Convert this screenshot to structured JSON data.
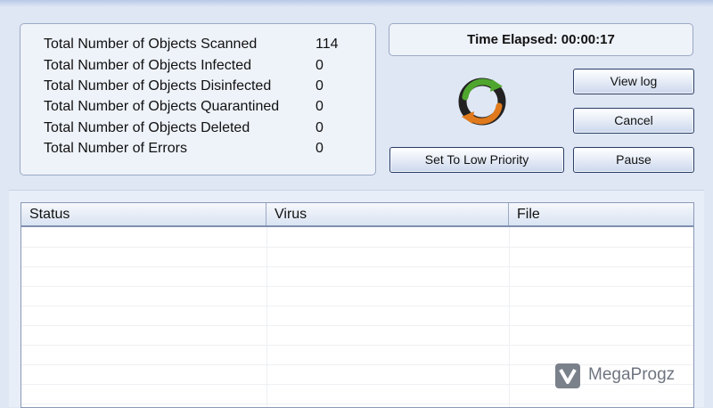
{
  "stats": [
    {
      "label": "Total Number of Objects Scanned",
      "value": "114"
    },
    {
      "label": "Total Number of Objects Infected",
      "value": "0"
    },
    {
      "label": "Total Number of Objects Disinfected",
      "value": "0"
    },
    {
      "label": "Total Number of Objects Quarantined",
      "value": "0"
    },
    {
      "label": "Total Number of Objects Deleted",
      "value": "0"
    },
    {
      "label": "Total Number of Errors",
      "value": "0"
    }
  ],
  "time_elapsed": "Time Elapsed: 00:00:17",
  "buttons": {
    "view_log": "View log",
    "cancel": "Cancel",
    "pause": "Pause",
    "low_priority": "Set To Low Priority"
  },
  "table": {
    "columns": [
      "Status",
      "Virus",
      "File"
    ]
  },
  "watermark": "MegaProgz",
  "colors": {
    "spinner_green": "#4fa62e",
    "spinner_orange": "#e07a1c"
  }
}
